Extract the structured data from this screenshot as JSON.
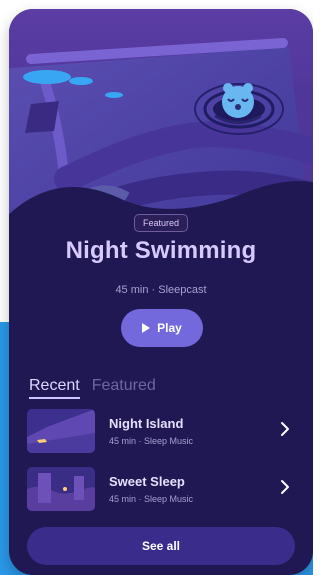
{
  "colors": {
    "page_background": "#ffffff",
    "blue_background": "#2a99e9",
    "phone_background": "#1f1852",
    "title_text": "#d8c9ff",
    "play_button": "#7469dc",
    "see_all_button": "#3a2c8b"
  },
  "hero": {
    "badge": "Featured",
    "title": "Night Swimming",
    "meta": "45 min · Sleepcast",
    "play_label": "Play",
    "icons": {
      "play": "play-icon",
      "mascot": "bear-icon",
      "hero_image": "night-swimming-illustration"
    }
  },
  "tabs": [
    {
      "label": "Recent",
      "active": true
    },
    {
      "label": "Featured",
      "active": false
    }
  ],
  "list": [
    {
      "title": "Night Island",
      "meta": "45 min · Sleep Music",
      "thumbnail": "night-island-thumbnail",
      "chevron": "chevron-right-icon"
    },
    {
      "title": "Sweet Sleep",
      "meta": "45 min · Sleep Music",
      "thumbnail": "sweet-sleep-thumbnail",
      "chevron": "chevron-right-icon"
    }
  ],
  "footer": {
    "see_all_label": "See all"
  }
}
